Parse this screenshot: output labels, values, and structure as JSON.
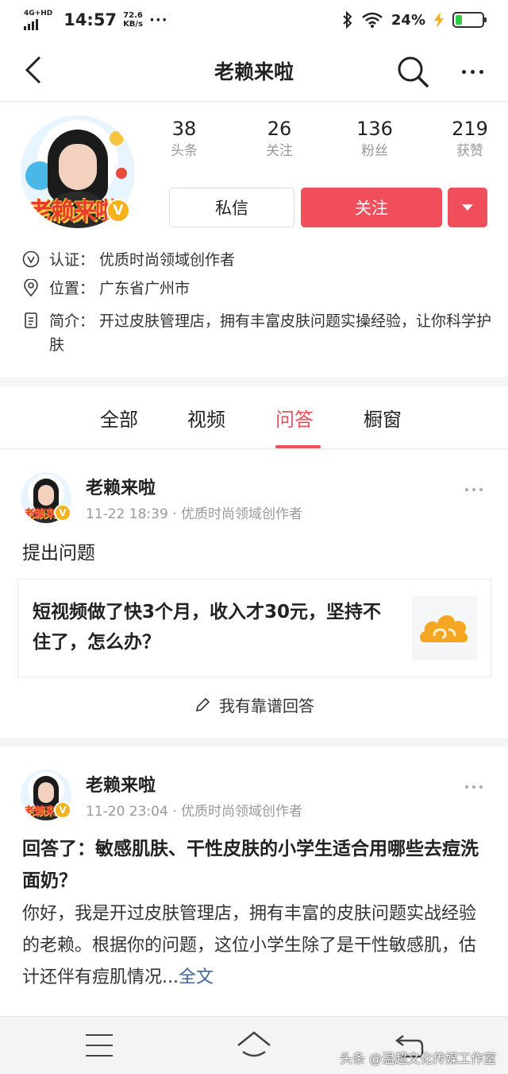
{
  "status_bar": {
    "network": "4G+HD",
    "time": "14:57",
    "speed_value": "72.6",
    "speed_unit": "KB/s",
    "more": "···",
    "battery_pct": "24%",
    "battery_level": 0.24,
    "battery_color": "#2ecc40"
  },
  "nav": {
    "title": "老赖来啦",
    "back_icon": "chevron-left-icon",
    "search_icon": "search-icon",
    "more_icon": "more-horizontal-icon"
  },
  "profile": {
    "avatar_text": "老赖来啦",
    "verified_badge": "V",
    "stats": [
      {
        "num": "38",
        "label": "头条"
      },
      {
        "num": "26",
        "label": "关注"
      },
      {
        "num": "136",
        "label": "粉丝"
      },
      {
        "num": "219",
        "label": "获赞"
      }
    ],
    "message_label": "私信",
    "follow_label": "关注",
    "accent_color": "#f04e5a",
    "verification": "认证： 优质时尚领域创作者",
    "location": "位置： 广东省广州市",
    "intro": "简介： 开过皮肤管理店，拥有丰富皮肤问题实操经验，让你科学护肤"
  },
  "tabs": [
    {
      "label": "全部",
      "active": false
    },
    {
      "label": "视频",
      "active": false
    },
    {
      "label": "问答",
      "active": true
    },
    {
      "label": "橱窗",
      "active": false
    }
  ],
  "posts": [
    {
      "author": "老赖来啦",
      "meta": "11-22 18:39 · 优质时尚领域创作者",
      "type_label": "提出问题",
      "question_title": "短视频做了快3个月，收入才30元，坚持不住了，怎么办？",
      "answer_link": "我有靠谱回答"
    },
    {
      "author": "老赖来啦",
      "meta": "11-20 23:04 · 优质时尚领域创作者",
      "answer_title": "回答了：敏感肌肤、干性皮肤的小学生适合用哪些去痘洗面奶？",
      "answer_body": "你好，我是开过皮肤管理店，拥有丰富的皮肤问题实战经验的老赖。根据你的问题，这位小学生除了是干性敏感肌，估计还伴有痘肌情况...",
      "more_label": "全文"
    }
  ],
  "bottom_nav": {
    "menu_icon": "menu-icon",
    "home_icon": "home-icon",
    "back_icon": "back-icon"
  },
  "watermark": "头条 @温超文化传媒工作室"
}
